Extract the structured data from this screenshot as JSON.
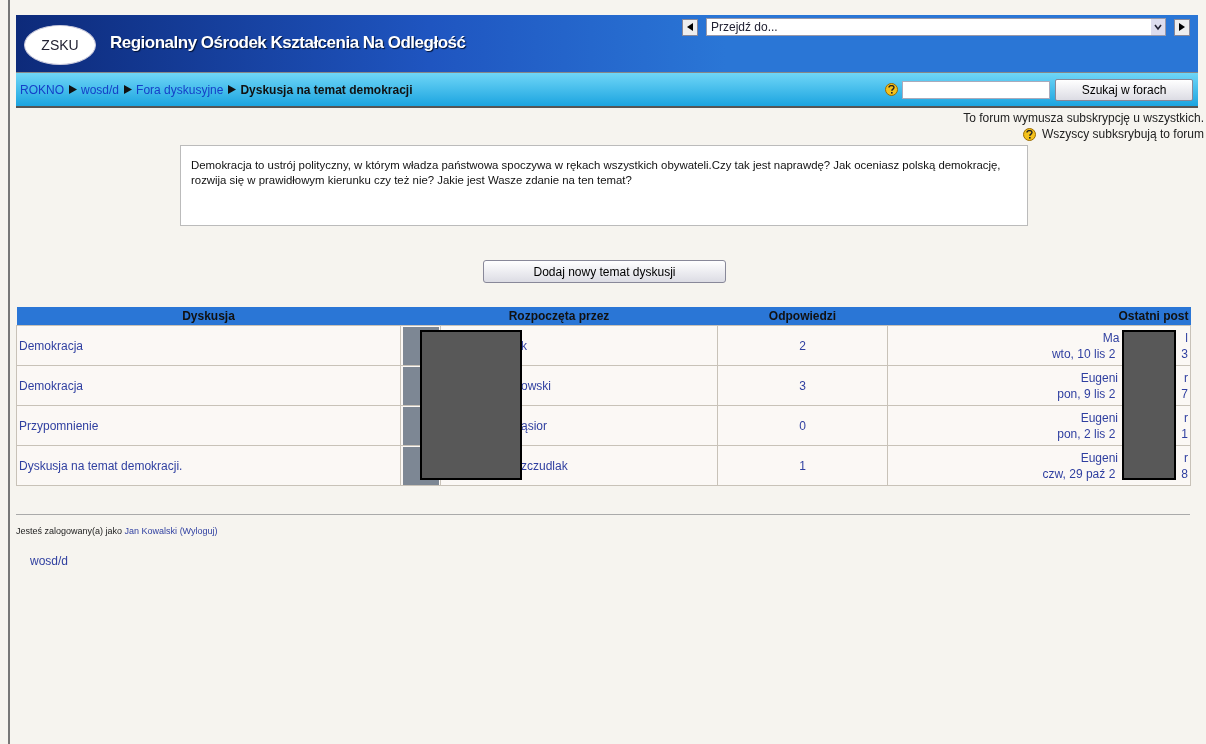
{
  "header": {
    "logo_text": "ZSKU",
    "title": "Regionalny Ośrodek Kształcenia Na Odległość",
    "jump_menu": {
      "value": "Przejdź do..."
    }
  },
  "breadcrumbs": [
    {
      "label": "ROKNO",
      "kind": "link"
    },
    {
      "label": "wosd/d",
      "kind": "link"
    },
    {
      "label": "Fora dyskusyjne",
      "kind": "link"
    },
    {
      "label": "Dyskusja na temat demokracji",
      "kind": "current"
    }
  ],
  "search": {
    "button": "Szukaj w forach"
  },
  "notices": {
    "forced": "To forum wymusza subskrypcję u wszystkich.",
    "all_subscribed": "Wszyscy subksrybują to forum"
  },
  "description": "Demokracja to ustrój polityczny, w którym władza państwowa spoczywa w rękach wszystkich obywateli.Czy tak jest naprawdę? Jak oceniasz polską demokrację, rozwija się w prawidłowym kierunku czy też nie? Jakie jest Wasze zdanie na ten temat?",
  "add_button": "Dodaj nowy temat dyskusji",
  "table": {
    "columns": [
      "Dyskusja",
      "Rozpoczęta przez",
      "Odpowiedzi",
      "Ostatni post"
    ],
    "rows": [
      {
        "topic": "Demokracja",
        "author": "k",
        "replies": "2",
        "last_name": [
          "Ma",
          "l"
        ],
        "last_date": [
          "wto, 10 lis 2",
          "3"
        ]
      },
      {
        "topic": "Demokracja",
        "author": "owski",
        "replies": "3",
        "last_name": [
          "Eugeni",
          "r"
        ],
        "last_date": [
          "pon, 9 lis 2",
          "7"
        ]
      },
      {
        "topic": "Przypomnienie",
        "author": "ąsior",
        "replies": "0",
        "last_name": [
          "Eugeni",
          "r"
        ],
        "last_date": [
          "pon, 2 lis 2",
          "1"
        ]
      },
      {
        "topic": "Dyskusja na temat demokracji.",
        "author": "zczudlak",
        "replies": "1",
        "last_name": [
          "Eugeni",
          "r"
        ],
        "last_date": [
          "czw, 29 paź 2",
          "8"
        ]
      }
    ]
  },
  "footer": {
    "login_prefix": "Jesteś zalogowany(a) jako",
    "user": "Jan Kowalski",
    "logout": "(Wyloguj)",
    "course": "wosd/d"
  }
}
